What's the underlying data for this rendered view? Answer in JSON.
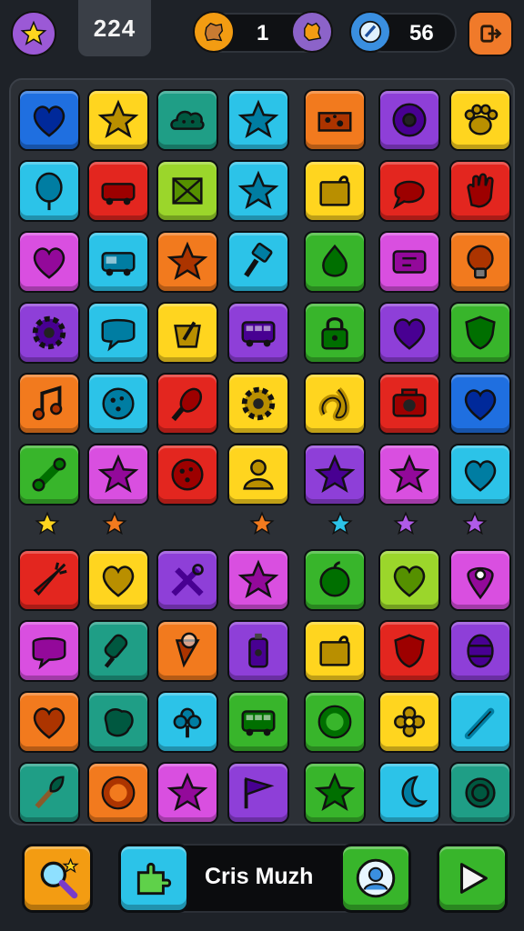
{
  "hud": {
    "level": "224",
    "coins": "1",
    "gems": "56",
    "colors": {
      "purple_btn": "#9b59d6",
      "orange_btn": "#f39c12",
      "gem_blue": "#3a8fe0",
      "exit_btn": "#f07a2a"
    },
    "icons": [
      "star-icon",
      "cookie-icon",
      "gear-coin-icon",
      "clock-gem-icon",
      "exit-icon"
    ]
  },
  "board": {
    "colors": {
      "purple": "#8e3fd8",
      "yellow": "#ffd51f",
      "teal": "#1f9e86",
      "cyan": "#2cc3e8",
      "orange": "#f27a1e",
      "red": "#e3261f",
      "green": "#38b52b",
      "magenta": "#d94fe0",
      "blue": "#1f6fe0",
      "lime": "#9bd62b"
    },
    "top_rows": [
      [
        "blue:heart-icon",
        "yellow:star-icon",
        "teal:cloud-icon",
        "cyan:star-icon",
        "orange:cheese-icon",
        "purple:donut-icon",
        "yellow:paw-icon"
      ],
      [
        "cyan:balloon-icon",
        "red:car-icon",
        "lime:crate-icon",
        "cyan:star-icon",
        "yellow:box-icon",
        "red:bubble-icon",
        "red:hand-icon"
      ],
      [
        "magenta:heart-icon",
        "cyan:van-icon",
        "orange:star-icon",
        "cyan:brush-icon",
        "green:drop-icon",
        "magenta:ticket-icon",
        "orange:bulb-icon"
      ],
      [
        "purple:gear-icon",
        "cyan:chat-icon",
        "yellow:bucket-icon",
        "purple:bus-icon",
        "green:lock-icon",
        "purple:heart-icon",
        "green:shield-icon"
      ],
      [
        "orange:music-icon",
        "cyan:cookie-icon",
        "red:corn-icon",
        "yellow:gear-icon",
        "yellow:knot-icon",
        "red:camera-icon",
        "blue:heart-icon"
      ],
      [
        "green:bone-icon",
        "magenta:star-icon",
        "red:cookie-icon",
        "yellow:user-icon",
        "purple:star-icon",
        "magenta:star-icon",
        "cyan:heart-icon"
      ]
    ],
    "stars": [
      "yellow",
      "orange",
      "orange",
      "cyan",
      "purple",
      "purple"
    ],
    "bottom_rows": [
      [
        "red:carrot-icon",
        "yellow:heart-icon",
        "purple:tools-icon",
        "magenta:star-icon",
        "green:apple-icon",
        "lime:heart-icon",
        "magenta:pin-icon"
      ],
      [
        "magenta:chat-icon",
        "teal:icepop-icon",
        "orange:cone-icon",
        "purple:bottle-icon",
        "yellow:box-icon",
        "red:shield-icon",
        "purple:barrel-icon"
      ],
      [
        "orange:heart-icon",
        "teal:blob-icon",
        "cyan:clover-icon",
        "green:bus-icon",
        "green:ring-icon",
        "yellow:flower-icon",
        "cyan:bat-icon"
      ],
      [
        "teal:torch-icon",
        "orange:ring-icon",
        "magenta:star-icon",
        "purple:flag-icon",
        "green:star-icon",
        "cyan:moon-icon",
        "teal:orb-icon"
      ]
    ]
  },
  "footer": {
    "player_name": "Cris Muzh",
    "icons": [
      "magnifier-icon",
      "puzzle-icon",
      "avatar-icon",
      "play-icon"
    ]
  }
}
